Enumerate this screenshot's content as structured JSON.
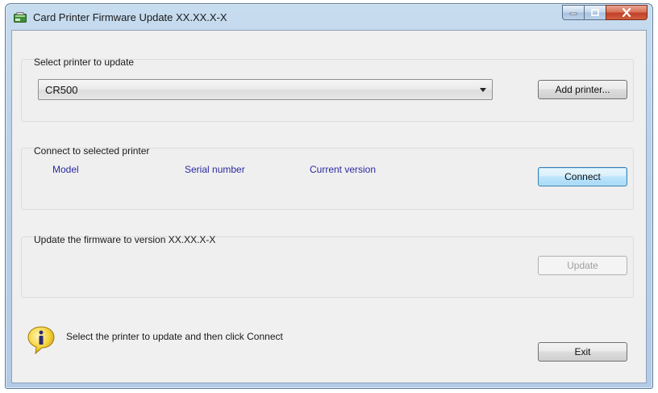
{
  "window": {
    "title": "Card Printer Firmware Update XX.XX.X-X"
  },
  "select_group": {
    "label": "Select printer to update",
    "printer_value": "CR500",
    "add_printer_label": "Add printer..."
  },
  "connect_group": {
    "label": "Connect to selected printer",
    "columns": [
      "Model",
      "Serial number",
      "Current version"
    ],
    "connect_label": "Connect"
  },
  "update_group": {
    "label": "Update the firmware to version XX.XX.X-X",
    "update_label": "Update"
  },
  "status": {
    "message": "Select the printer to update and then click Connect",
    "icon": "info-icon"
  },
  "exit_label": "Exit",
  "colors": {
    "column_header": "#2a2aa0",
    "default_button_border": "#3c7fb1",
    "close_button": "#c0402a"
  }
}
